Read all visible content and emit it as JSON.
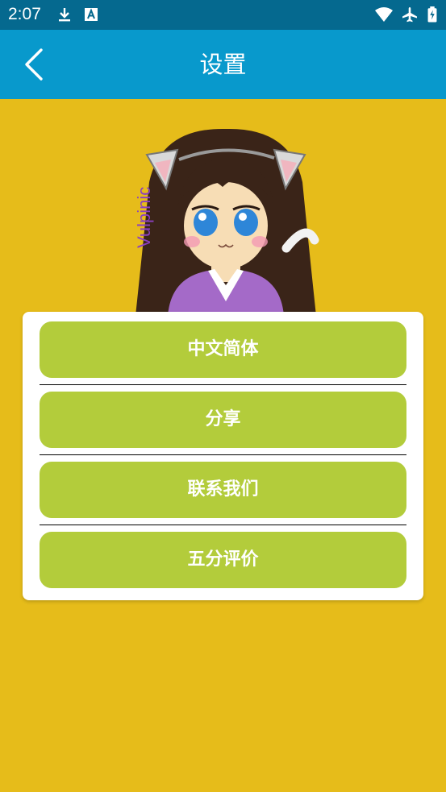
{
  "status_bar": {
    "time": "2:07",
    "left_icons": [
      "download-icon",
      "text-format-icon"
    ],
    "right_icons": [
      "wifi-icon",
      "airplane-icon",
      "battery-icon"
    ]
  },
  "app_bar": {
    "title": "设置",
    "back_icon": "back-arrow-icon",
    "color": "#0899cc"
  },
  "mascot": {
    "signature": "Vulpinic"
  },
  "menu": {
    "items": [
      {
        "label": "中文简体"
      },
      {
        "label": "分享"
      },
      {
        "label": "联系我们"
      },
      {
        "label": "五分评价"
      }
    ]
  },
  "colors": {
    "background": "#e6bc1a",
    "button": "#b3cc3b",
    "status_bar": "#05698f"
  }
}
